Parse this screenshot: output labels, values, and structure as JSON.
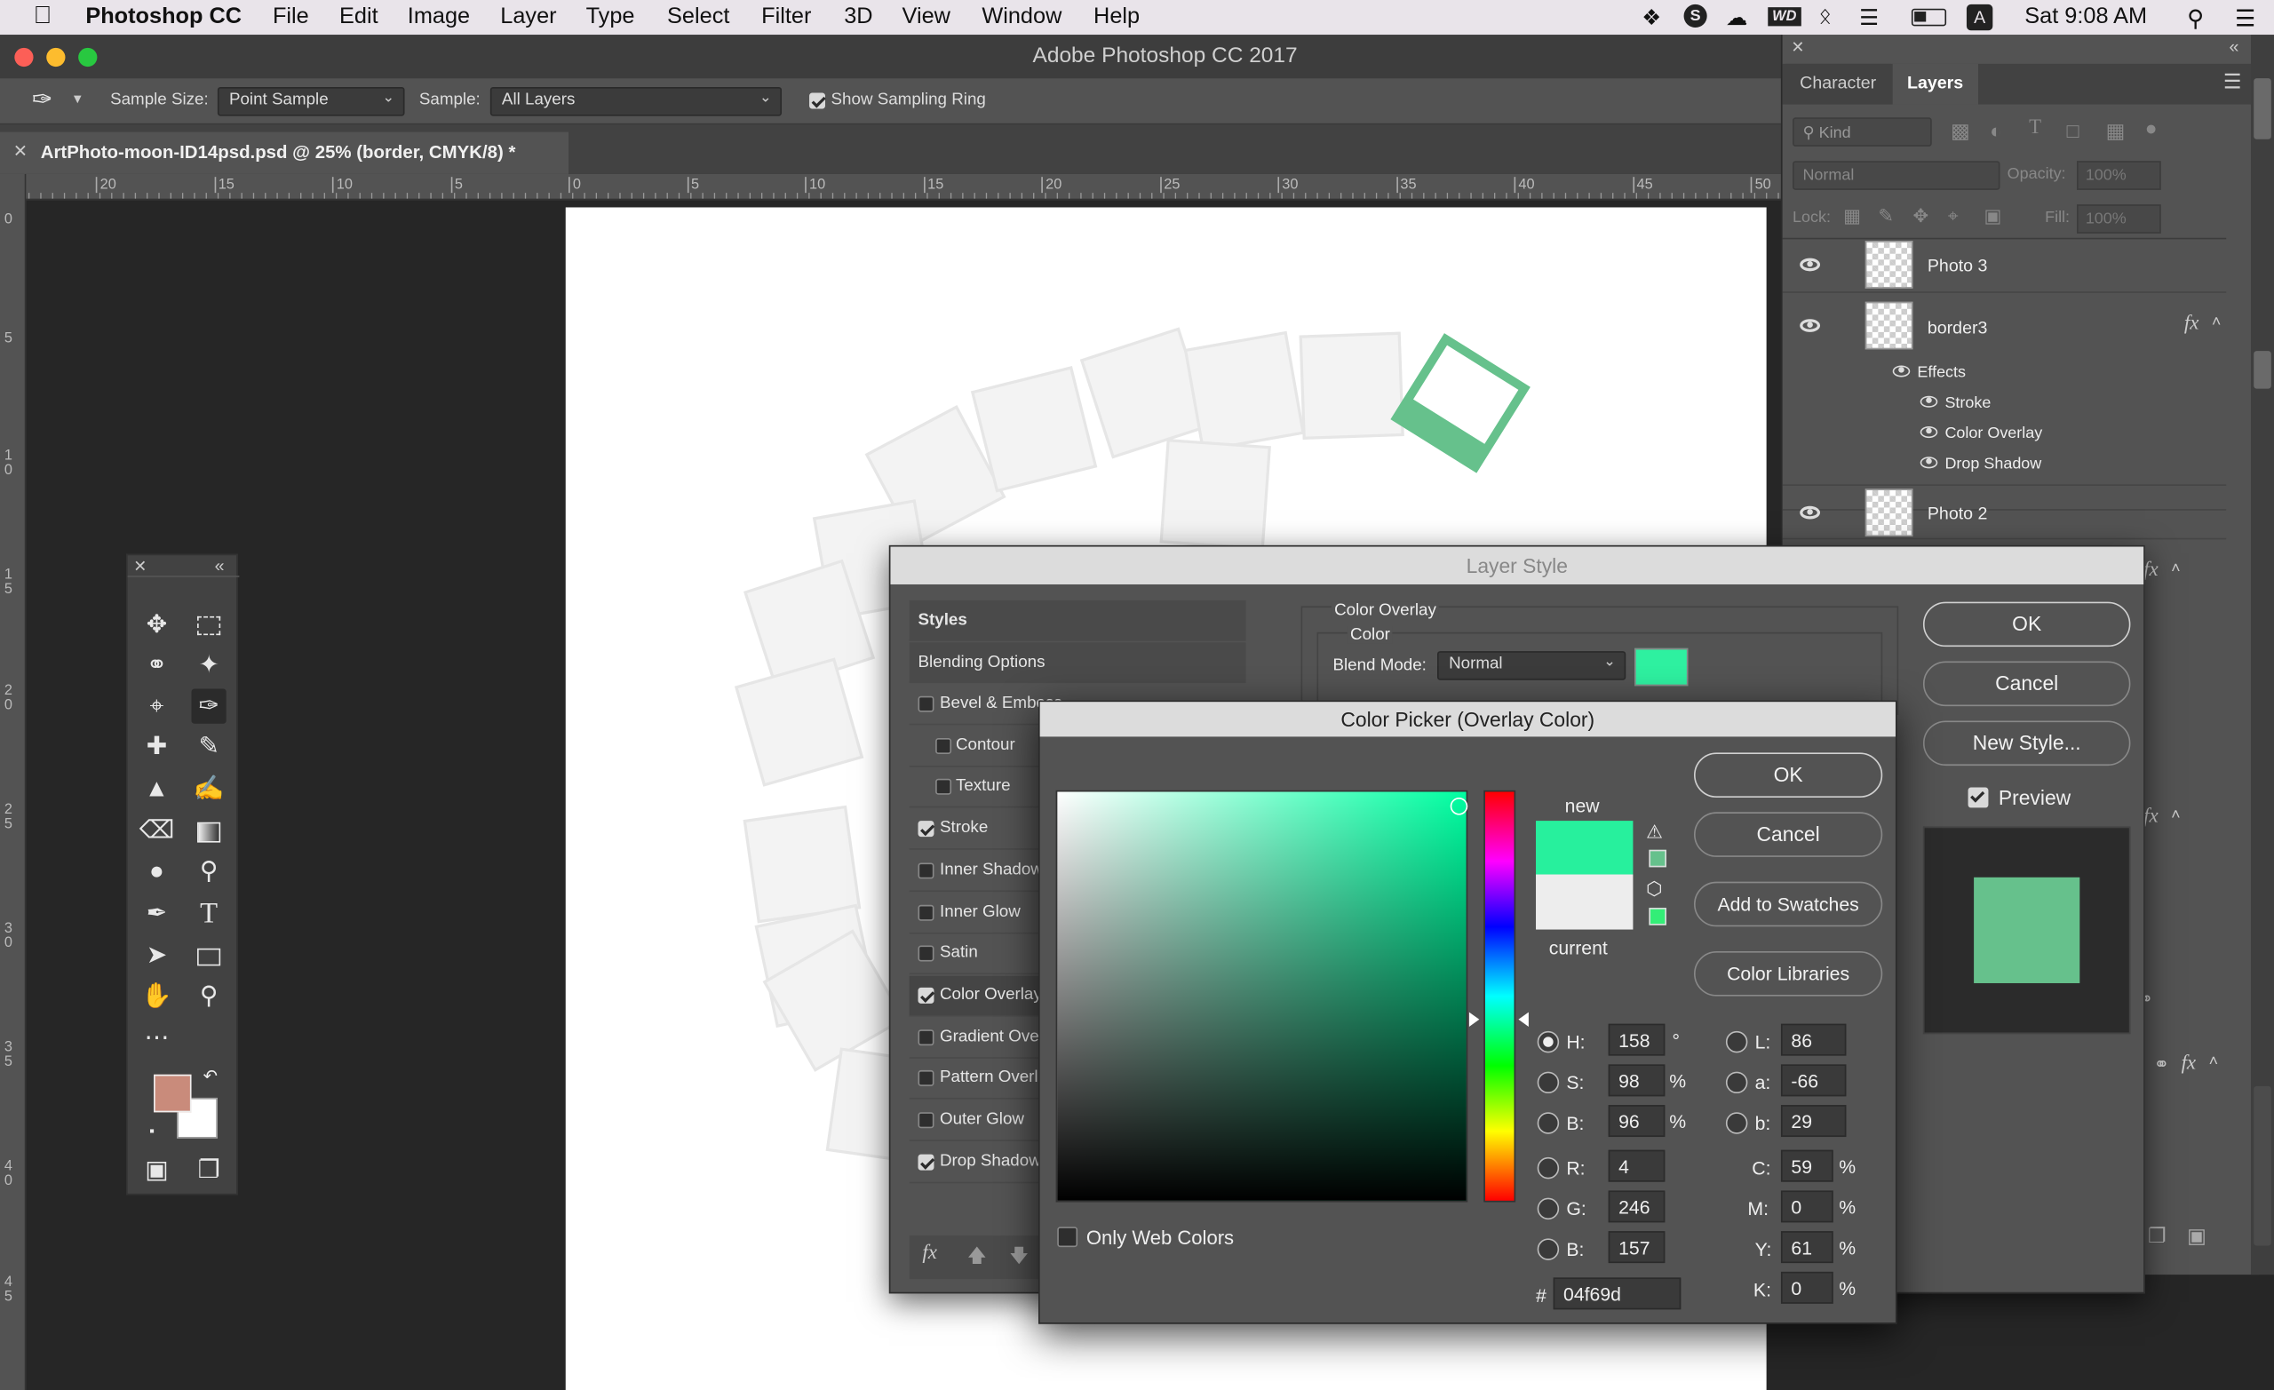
{
  "menubar": {
    "app": "Photoshop CC",
    "items": [
      "File",
      "Edit",
      "Image",
      "Layer",
      "Type",
      "Select",
      "Filter",
      "3D",
      "View",
      "Window",
      "Help"
    ],
    "clock": "Sat 9:08 AM",
    "wd": "WD",
    "user_initial": "A"
  },
  "window": {
    "title": "Adobe Photoshop CC 2017"
  },
  "options": {
    "sample_size_label": "Sample Size:",
    "sample_size_value": "Point Sample",
    "sample_label": "Sample:",
    "sample_value": "All Layers",
    "ring_label": "Show Sampling Ring",
    "ring_checked": true
  },
  "document": {
    "tab": "ArtPhoto-moon-ID14psd.psd @ 25% (border, CMYK/8) *"
  },
  "rulers": {
    "h": [
      "20",
      "15",
      "10",
      "5",
      "0",
      "5",
      "10",
      "15",
      "20",
      "25",
      "30",
      "35",
      "40",
      "45",
      "50"
    ],
    "v": [
      "0",
      "5",
      "1\n0",
      "1\n5",
      "2\n0",
      "2\n5",
      "3\n0",
      "3\n5",
      "4\n0",
      "4\n5"
    ]
  },
  "panel": {
    "tabs": [
      "Character",
      "Layers"
    ],
    "kind": "Kind",
    "blend": "Normal",
    "opacity_label": "Opacity:",
    "opacity_value": "100%",
    "lock_label": "Lock:",
    "fill_label": "Fill:",
    "fill_value": "100%",
    "layers": [
      {
        "name": "Photo 3"
      },
      {
        "name": "border3",
        "fx": "fx"
      },
      {
        "name": "Photo 2"
      }
    ],
    "effects_label": "Effects",
    "effects": [
      "Stroke",
      "Color Overlay",
      "Drop Shadow"
    ],
    "fx": "fx"
  },
  "layer_style": {
    "title": "Layer Style",
    "styles_header": "Styles",
    "blending": "Blending Options",
    "items": [
      {
        "label": "Bevel & Emboss",
        "checked": false
      },
      {
        "label": "Contour",
        "checked": false,
        "indent": true
      },
      {
        "label": "Texture",
        "checked": false,
        "indent": true
      },
      {
        "label": "Stroke",
        "checked": true
      },
      {
        "label": "Inner Shadow",
        "checked": false
      },
      {
        "label": "Inner Glow",
        "checked": false
      },
      {
        "label": "Satin",
        "checked": false
      },
      {
        "label": "Color Overlay",
        "checked": true,
        "selected": true
      },
      {
        "label": "Gradient Overlay",
        "checked": false
      },
      {
        "label": "Pattern Overlay",
        "checked": false
      },
      {
        "label": "Outer Glow",
        "checked": false
      },
      {
        "label": "Drop Shadow",
        "checked": true
      }
    ],
    "section_title": "Color Overlay",
    "section_sub": "Color",
    "blend_mode_label": "Blend Mode:",
    "blend_mode_value": "Normal",
    "overlay_color": "#2ef0a0",
    "ok": "OK",
    "cancel": "Cancel",
    "new_style": "New Style...",
    "preview_label": "Preview",
    "preview_checked": true,
    "preview_color": "#66c18c",
    "fx": "fx"
  },
  "color_picker": {
    "title": "Color Picker (Overlay Color)",
    "ok": "OK",
    "cancel": "Cancel",
    "add_swatches": "Add to Swatches",
    "color_libraries": "Color Libraries",
    "new_label": "new",
    "current_label": "current",
    "new_color": "#27f09d",
    "current_color": "#ededed",
    "only_web": "Only Web Colors",
    "hsb": {
      "H": "158",
      "S": "98",
      "B": "96"
    },
    "rgb": {
      "R": "4",
      "G": "246",
      "B": "157"
    },
    "lab": {
      "L": "86",
      "a": "-66",
      "b": "29"
    },
    "cmyk": {
      "C": "59",
      "M": "0",
      "Y": "61",
      "K": "0"
    },
    "hex": "04f69d",
    "units": {
      "deg": "°",
      "pct": "%"
    }
  }
}
